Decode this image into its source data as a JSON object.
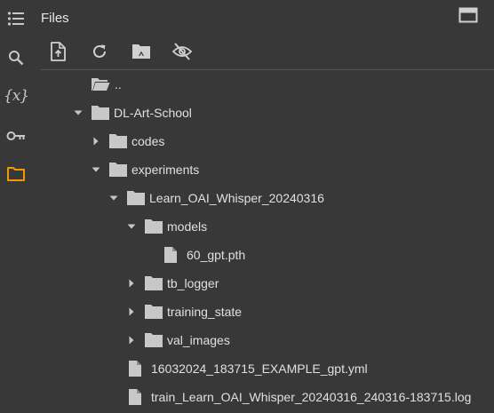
{
  "panel": {
    "title": "Files",
    "rail": [
      "table-of-contents-icon",
      "search-icon",
      "variables-icon",
      "secrets-key-icon",
      "files-folder-icon"
    ],
    "variables_glyph": "{x}",
    "toolbar": [
      "upload-file-icon",
      "refresh-icon",
      "mount-drive-icon",
      "hide-files-icon"
    ],
    "accent_color": "#f29900"
  },
  "tree": [
    {
      "label": "..",
      "type": "parent",
      "expanded": null
    },
    {
      "label": "DL-Art-School",
      "type": "folder",
      "expanded": true
    },
    {
      "label": "codes",
      "type": "folder",
      "expanded": false
    },
    {
      "label": "experiments",
      "type": "folder",
      "expanded": true
    },
    {
      "label": "Learn_OAI_Whisper_20240316",
      "type": "folder",
      "expanded": true
    },
    {
      "label": "models",
      "type": "folder",
      "expanded": true
    },
    {
      "label": "60_gpt.pth",
      "type": "file",
      "expanded": null
    },
    {
      "label": "tb_logger",
      "type": "folder",
      "expanded": false
    },
    {
      "label": "training_state",
      "type": "folder",
      "expanded": false
    },
    {
      "label": "val_images",
      "type": "folder",
      "expanded": false
    },
    {
      "label": "16032024_183715_EXAMPLE_gpt.yml",
      "type": "file",
      "expanded": null
    },
    {
      "label": "train_Learn_OAI_Whisper_20240316_240316-183715.log",
      "type": "file",
      "expanded": null
    }
  ]
}
